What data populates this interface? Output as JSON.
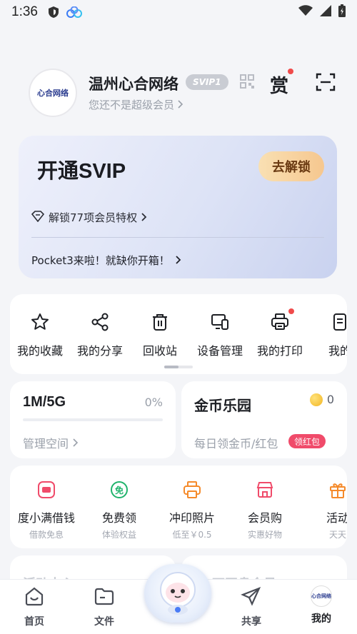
{
  "status_bar": {
    "time": "1:36"
  },
  "profile": {
    "avatar_text": "心合网络",
    "username": "温州心合网络",
    "svip_badge": "SVIP1",
    "member_status": "您还不是超级会员",
    "reward_icon_text": "赏"
  },
  "svip_card": {
    "title": "开通SVIP",
    "unlock_label": "去解锁",
    "perk_text": "解锁77项会员特权",
    "promo_text": "Pocket3来啦！就缺你开箱！"
  },
  "tools": [
    {
      "label": "我的收藏",
      "icon": "star-icon"
    },
    {
      "label": "我的分享",
      "icon": "share-icon"
    },
    {
      "label": "回收站",
      "icon": "trash-icon"
    },
    {
      "label": "设备管理",
      "icon": "devices-icon"
    },
    {
      "label": "我的打印",
      "icon": "printer-icon"
    },
    {
      "label": "我的",
      "icon": "doc-icon"
    }
  ],
  "storage": {
    "size": "1M/5G",
    "percent_text": "0%",
    "used_fraction": 0.0,
    "link": "管理空间"
  },
  "coins": {
    "title": "金币乐园",
    "count": "0",
    "subtitle": "每日领金币/红包",
    "badge": "领红包"
  },
  "services": [
    {
      "label": "度小满借钱",
      "sub": "借款免息",
      "icon": "wallet-icon",
      "color": "#f04b6a"
    },
    {
      "label": "免费领",
      "sub": "体验权益",
      "icon": "free-icon",
      "color": "#1fb36b"
    },
    {
      "label": "冲印照片",
      "sub": "低至￥0.5",
      "icon": "photo-print-icon",
      "color": "#f58a2a"
    },
    {
      "label": "会员购",
      "sub": "实惠好物",
      "icon": "store-icon",
      "color": "#f04b6a"
    },
    {
      "label": "活动",
      "sub": "天天",
      "icon": "gift-icon",
      "color": "#f58a2a"
    }
  ],
  "peek": {
    "left": "活动中心",
    "right": "10万网盘会员"
  },
  "tabbar": {
    "home": "首页",
    "files": "文件",
    "share": "共享",
    "mine": "我的",
    "mine_avatar_text": "心合网络"
  }
}
